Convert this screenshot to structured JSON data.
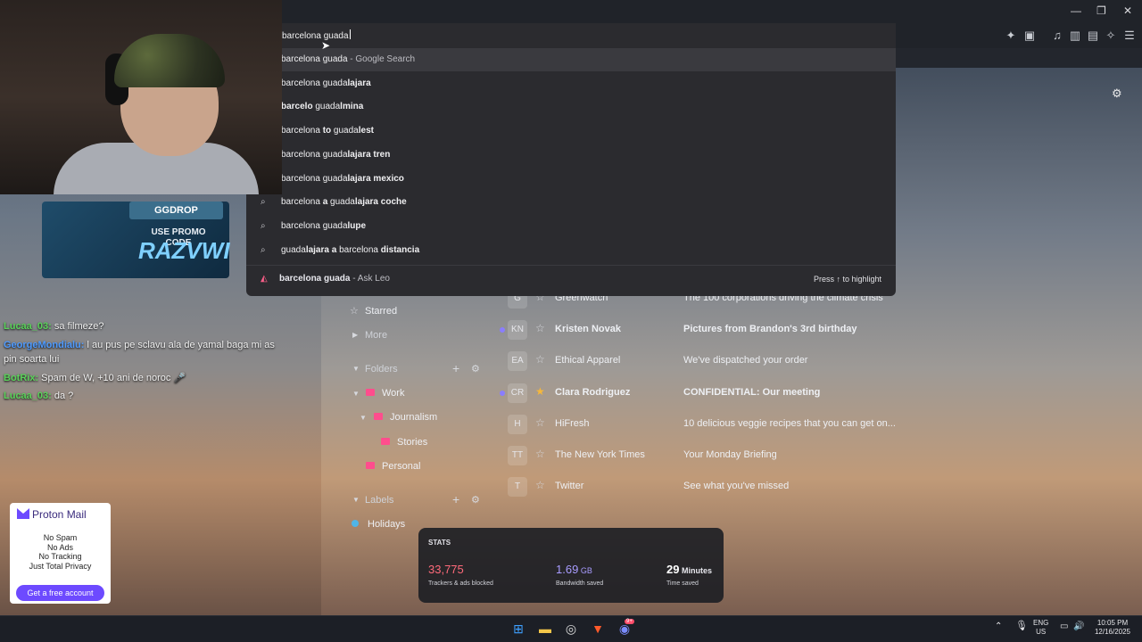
{
  "window": {
    "minimize": "—",
    "restore": "❐",
    "close": "✕"
  },
  "omnibox": {
    "query": "barcelona guada",
    "suggestions": [
      {
        "pre": "barcelona guada",
        "bold": "",
        "suffix": " - Google Search",
        "selected": true
      },
      {
        "pre": "barcelona guada",
        "bold": "lajara",
        "suffix": ""
      },
      {
        "pre": "",
        "bold": "barcelo",
        "mid": " guada",
        "bold2": "lmina",
        "suffix": ""
      },
      {
        "pre": "barcelona ",
        "bold": "to",
        "mid": " guada",
        "bold2": "lest",
        "suffix": ""
      },
      {
        "pre": "barcelona guada",
        "bold": "lajara tren",
        "suffix": ""
      },
      {
        "pre": "barcelona guada",
        "bold": "lajara mexico",
        "suffix": ""
      },
      {
        "pre": "barcelona ",
        "bold": "a",
        "mid": " guada",
        "bold2": "lajara coche",
        "suffix": ""
      },
      {
        "pre": "barcelona guada",
        "bold": "lupe",
        "suffix": ""
      },
      {
        "pre": "guada",
        "bold": "lajara a",
        "mid": " barcelona ",
        "bold2": "distancia",
        "suffix": ""
      }
    ],
    "leo": {
      "query": "barcelona guada",
      "suffix": " - Ask Leo",
      "hint": "Press ↑ to highlight"
    }
  },
  "promo": {
    "brand": "GGDROP",
    "line": "USE PROMO CODE",
    "code": "RAZVWI"
  },
  "chat": [
    {
      "user": "Lucaa_03:",
      "text": " sa filmeze?",
      "color": "#5ad35a"
    },
    {
      "user": "GeorgeMondialu:",
      "text": " l au pus pe sclavu ala de yamal baga mi as",
      "color": "#4f9bff"
    },
    {
      "user": "",
      "text": "pin soarta lui",
      "color": "#4f9bff"
    },
    {
      "user": "BotRix:",
      "text": " Spam de W, +10 ani de noroc 🎤",
      "color": "#5ad35a"
    },
    {
      "user": "Lucaa_03:",
      "text": " da ?",
      "color": "#5ad35a"
    }
  ],
  "proton": {
    "brand": "Proton Mail",
    "lines": [
      "No Spam",
      "No Ads",
      "No Tracking",
      "Just Total Privacy"
    ],
    "cta": "Get a free account"
  },
  "sidebar": {
    "starred": "Starred",
    "more": "More",
    "folders": "Folders",
    "folder_items": [
      {
        "label": "Work"
      },
      {
        "label": "Journalism"
      },
      {
        "label": "Stories"
      },
      {
        "label": "Personal"
      }
    ],
    "labels": "Labels",
    "label_items": [
      {
        "label": "Holidays"
      }
    ]
  },
  "mail": [
    {
      "initials": "G",
      "sender": "Greenwatch",
      "subject": "The 100 corporations driving the climate crisis",
      "unread": false,
      "starred": false
    },
    {
      "initials": "KN",
      "sender": "Kristen Novak",
      "subject": "Pictures from Brandon's 3rd birthday",
      "unread": true,
      "starred": false
    },
    {
      "initials": "EA",
      "sender": "Ethical Apparel",
      "subject": "We've dispatched your order",
      "unread": false,
      "starred": false
    },
    {
      "initials": "CR",
      "sender": "Clara Rodriguez",
      "subject": "CONFIDENTIAL: Our meeting",
      "unread": true,
      "starred": true
    },
    {
      "initials": "H",
      "sender": "HiFresh",
      "subject": "10 delicious veggie recipes that you can get on...",
      "unread": false,
      "starred": false
    },
    {
      "initials": "TT",
      "sender": "The New York Times",
      "subject": "Your Monday Briefing",
      "unread": false,
      "starred": false
    },
    {
      "initials": "T",
      "sender": "Twitter",
      "subject": "See what you've missed",
      "unread": false,
      "starred": false
    }
  ],
  "stats": {
    "title": "STATS",
    "items": [
      {
        "value": "33,775",
        "unit": "",
        "label": "Trackers & ads blocked",
        "color": "#ff6a7a"
      },
      {
        "value": "1.69",
        "unit": " GB",
        "label": "Bandwidth saved",
        "color": "#a99cff"
      },
      {
        "value": "29",
        "unit": " Minutes",
        "label": "Time saved",
        "color": "#ffffff"
      }
    ]
  },
  "taskbar": {
    "lang1": "ENG",
    "lang2": "US",
    "time": "10:05 PM",
    "date": "12/16/2025",
    "discord_badge": "9+"
  }
}
